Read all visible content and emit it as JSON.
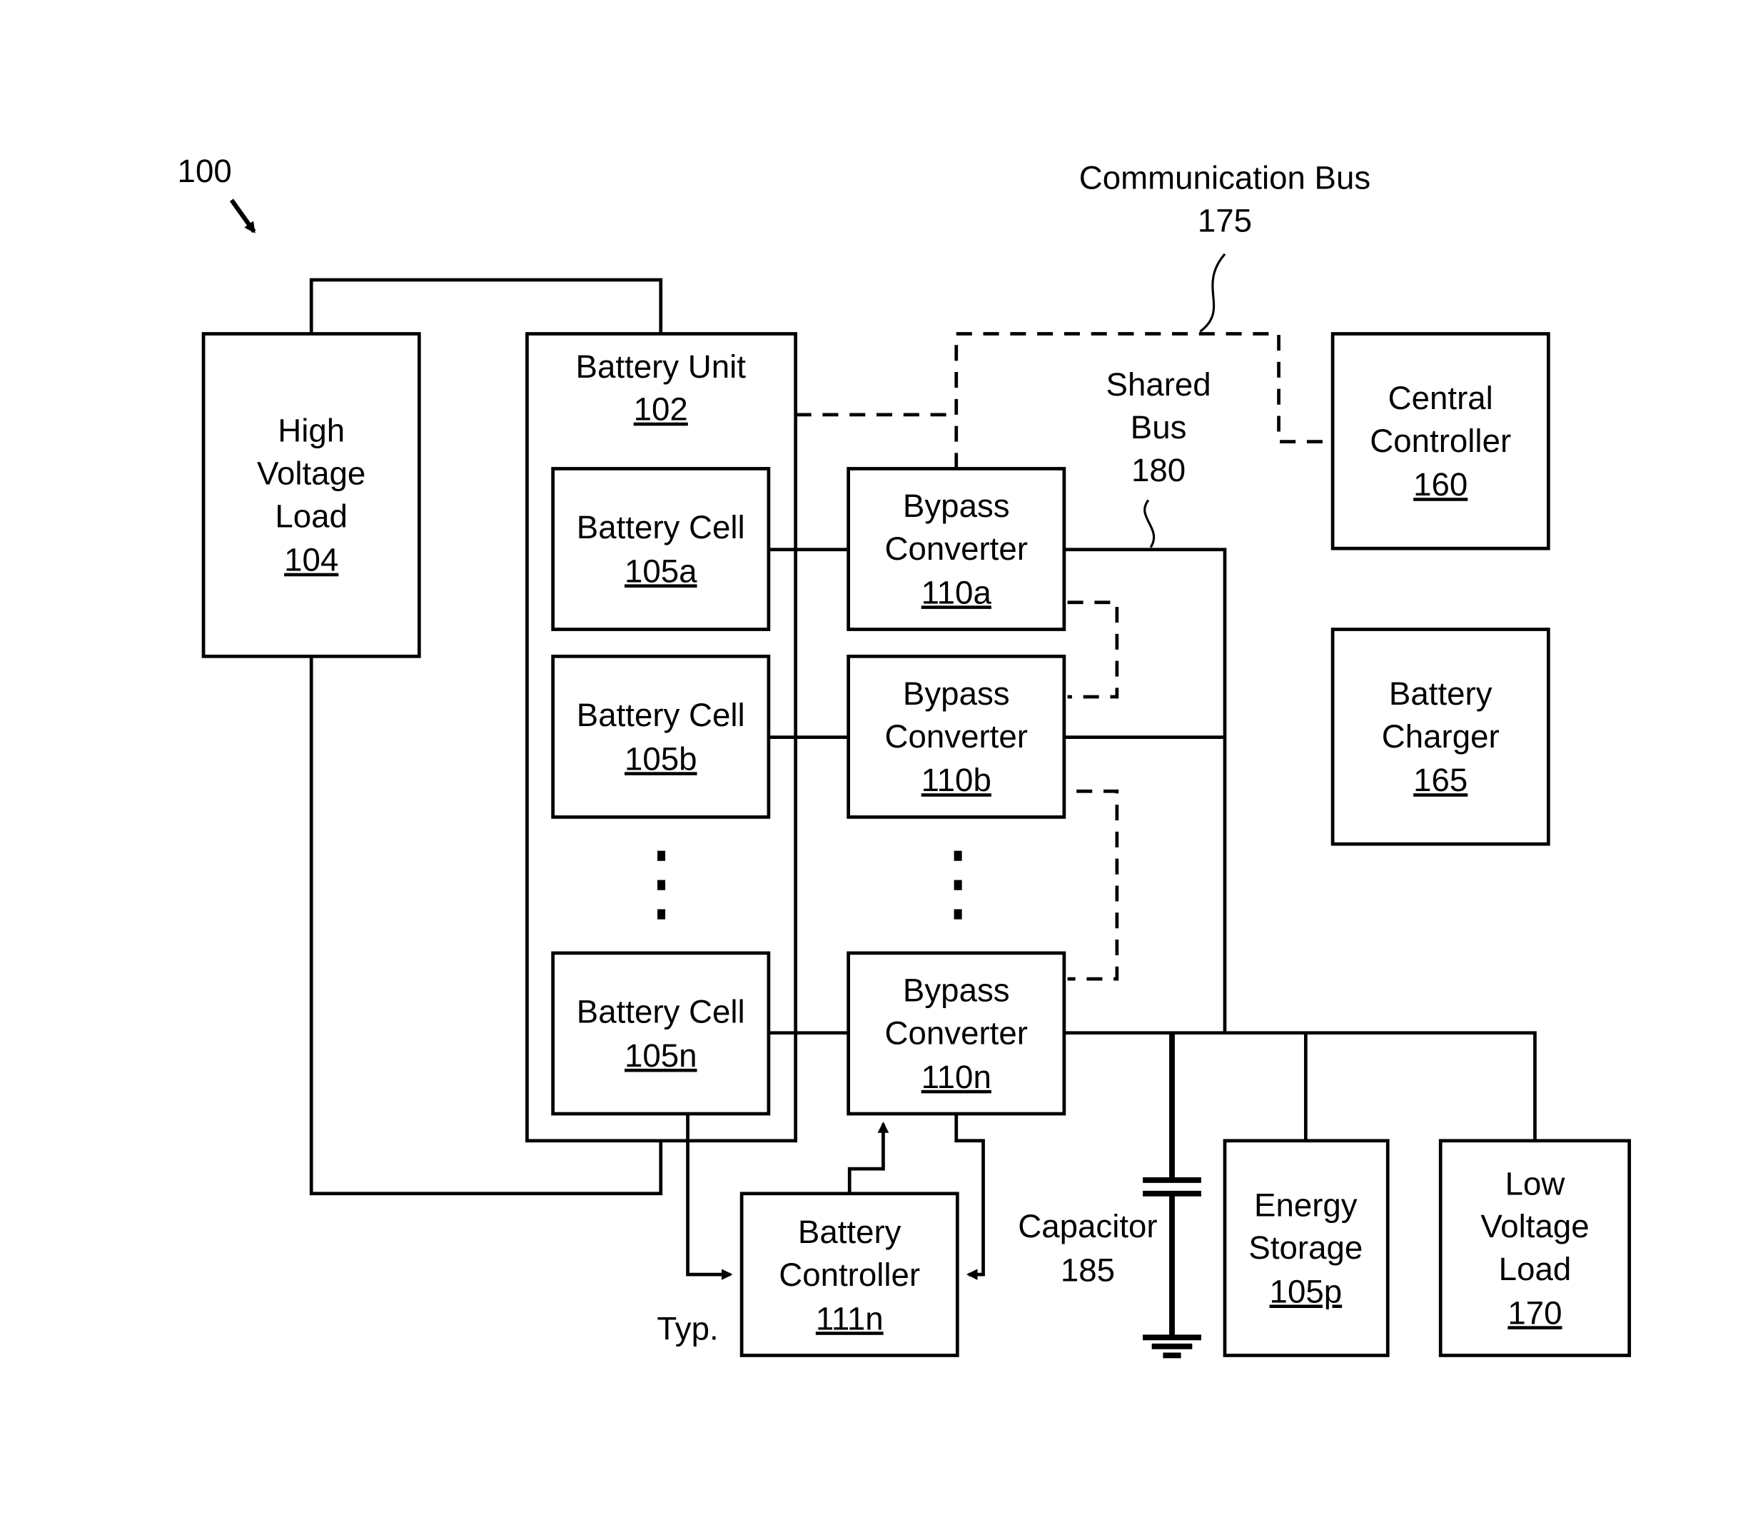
{
  "figure_ref": "100",
  "communication_bus": {
    "label": "Communication Bus",
    "ref": "175"
  },
  "shared_bus": {
    "line1": "Shared",
    "line2": "Bus",
    "ref": "180"
  },
  "high_voltage_load": {
    "line1": "High",
    "line2": "Voltage",
    "line3": "Load",
    "ref": "104"
  },
  "battery_unit": {
    "label": "Battery Unit",
    "ref": "102"
  },
  "cells": [
    {
      "label": "Battery Cell",
      "ref": "105a"
    },
    {
      "label": "Battery Cell",
      "ref": "105b"
    },
    {
      "label": "Battery Cell",
      "ref": "105n"
    }
  ],
  "converters": [
    {
      "line1": "Bypass",
      "line2": "Converter",
      "ref": "110a"
    },
    {
      "line1": "Bypass",
      "line2": "Converter",
      "ref": "110b"
    },
    {
      "line1": "Bypass",
      "line2": "Converter",
      "ref": "110n"
    }
  ],
  "central_controller": {
    "line1": "Central",
    "line2": "Controller",
    "ref": "160"
  },
  "battery_charger": {
    "line1": "Battery",
    "line2": "Charger",
    "ref": "165"
  },
  "battery_controller": {
    "line1": "Battery",
    "line2": "Controller",
    "ref": "111n",
    "note": "Typ."
  },
  "capacitor": {
    "label": "Capacitor",
    "ref": "185"
  },
  "energy_storage": {
    "line1": "Energy",
    "line2": "Storage",
    "ref": "105p"
  },
  "low_voltage_load": {
    "line1": "Low",
    "line2": "Voltage",
    "line3": "Load",
    "ref": "170"
  }
}
